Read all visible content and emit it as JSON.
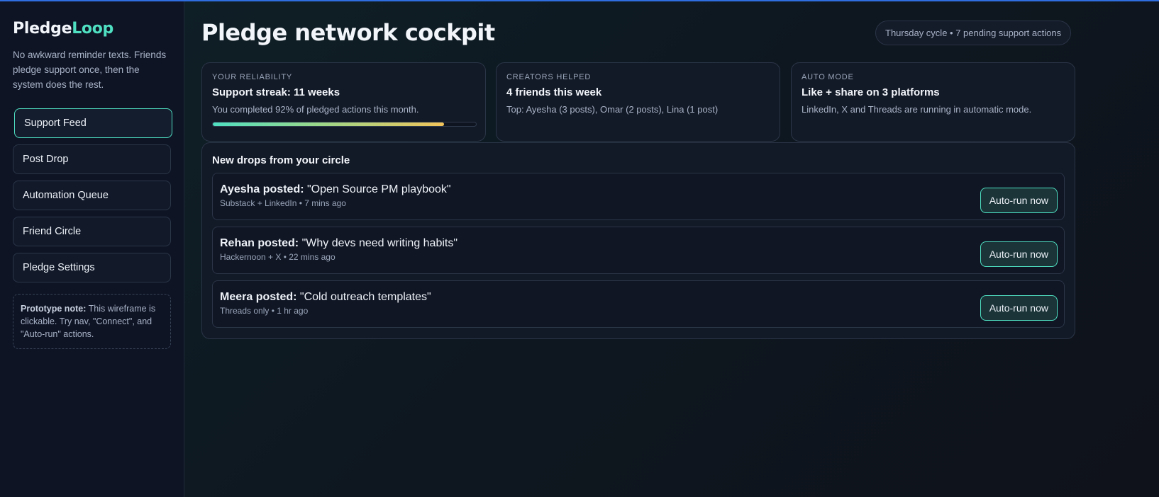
{
  "brand": {
    "name_part1": "Pledge",
    "name_part2": "Loop"
  },
  "sidebar": {
    "tagline": "No awkward reminder texts. Friends pledge support once, then the system does the rest.",
    "items": [
      {
        "label": "Support Feed",
        "active": true
      },
      {
        "label": "Post Drop",
        "active": false
      },
      {
        "label": "Automation Queue",
        "active": false
      },
      {
        "label": "Friend Circle",
        "active": false
      },
      {
        "label": "Pledge Settings",
        "active": false
      }
    ],
    "note_bold": "Prototype note:",
    "note_text": " This wireframe is clickable. Try nav, \"Connect\", and \"Auto-run\" actions."
  },
  "header": {
    "title": "Pledge network cockpit",
    "cycle": "Thursday cycle • 7 pending support actions"
  },
  "stats": [
    {
      "label": "YOUR RELIABILITY",
      "value": "Support streak: 11 weeks",
      "desc": "You completed 92% of pledged actions this month.",
      "progress": 0.88
    },
    {
      "label": "CREATORS HELPED",
      "value": "4 friends this week",
      "desc": "Top: Ayesha (3 posts), Omar (2 posts), Lina (1 post)"
    },
    {
      "label": "AUTO MODE",
      "value": "Like + share on 3 platforms",
      "desc": "LinkedIn, X and Threads are running in automatic mode."
    }
  ],
  "feed": {
    "title": "New drops from your circle",
    "drops": [
      {
        "author": "Ayesha posted:",
        "title": " \"Open Source PM playbook\"",
        "meta": "Substack + LinkedIn • 7 mins ago",
        "action": "Auto-run now"
      },
      {
        "author": "Rehan posted:",
        "title": " \"Why devs need writing habits\"",
        "meta": "Hackernoon + X • 22 mins ago",
        "action": "Auto-run now"
      },
      {
        "author": "Meera posted:",
        "title": " \"Cold outreach templates\"",
        "meta": "Threads only • 1 hr ago",
        "action": "Auto-run now"
      }
    ]
  },
  "colors": {
    "accent": "#4fe0c2",
    "progress_end": "#f2c45a",
    "top_line": "#2f6ee0"
  }
}
